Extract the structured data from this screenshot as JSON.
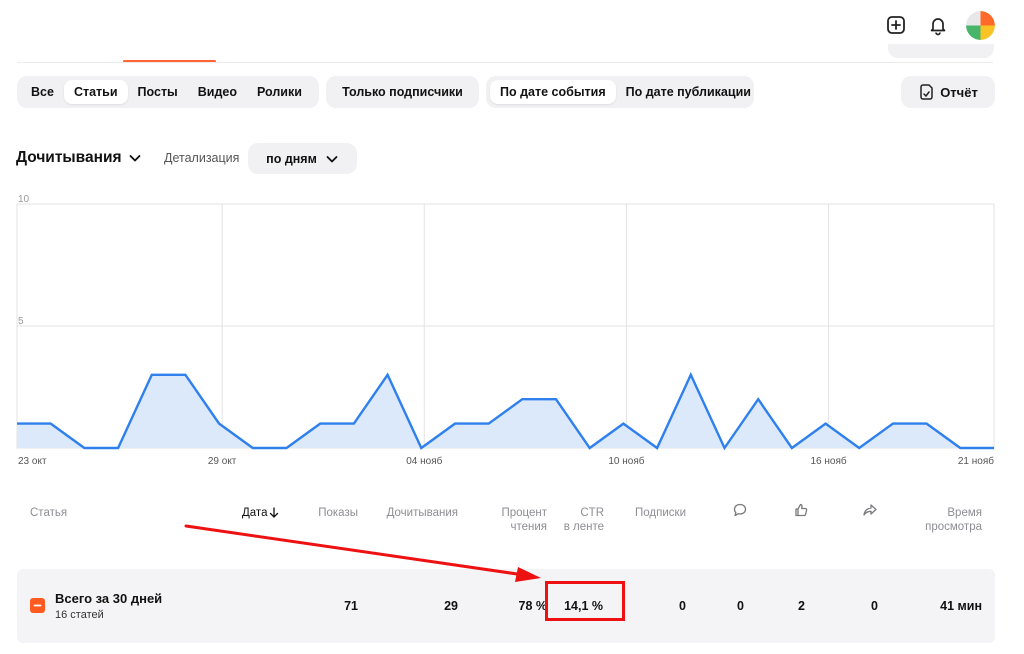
{
  "header": {
    "icons": [
      "plus-square-icon",
      "bell-icon",
      "avatar"
    ]
  },
  "filters": {
    "content_types": [
      "Все",
      "Статьи",
      "Посты",
      "Видео",
      "Ролики"
    ],
    "content_active": 1,
    "subscribers_only": "Только подписчики",
    "date_modes": [
      "По дате события",
      "По дате публикации"
    ],
    "date_active": 0,
    "report_label": "Отчёт"
  },
  "metric": {
    "title": "Дочитывания",
    "detail_label": "Детализация",
    "detail_value": "по дням"
  },
  "chart_data": {
    "type": "area",
    "y_ticks": [
      "10",
      "5",
      "0"
    ],
    "ylim": [
      0,
      10
    ],
    "x_tick_labels": [
      "23 окт",
      "29 окт",
      "04 нояб",
      "10 нояб",
      "16 нояб",
      "21 нояб"
    ],
    "x_start": "2024-10-23",
    "values": [
      1,
      1,
      0,
      0,
      3,
      3,
      1,
      0,
      0,
      1,
      1,
      3,
      0,
      1,
      1,
      2,
      2,
      0,
      1,
      0,
      3,
      0,
      2,
      0,
      1,
      0,
      1,
      1,
      0,
      0
    ],
    "line_color": "#2f80ed",
    "fill_color": "#dbe9fb"
  },
  "table": {
    "headers": {
      "article": "Статья",
      "date": "Дата",
      "views": "Показы",
      "reads": "Дочитывания",
      "read_pct_1": "Процент",
      "read_pct_2": "чтения",
      "ctr_1": "CTR",
      "ctr_2": "в ленте",
      "subs": "Подписки",
      "time_1": "Время",
      "time_2": "просмотра"
    },
    "header_icons": [
      "comment-icon",
      "like-icon",
      "share-icon"
    ],
    "summary": {
      "title": "Всего за 30 дней",
      "subtitle": "16 статей",
      "views": "71",
      "reads": "29",
      "read_pct": "78 %",
      "ctr": "14,1 %",
      "subs": "0",
      "comments": "0",
      "likes": "2",
      "shares": "0",
      "time": "41 мин"
    }
  },
  "colors": {
    "accent": "#ff5a1f",
    "annotation": "#ee1111"
  }
}
